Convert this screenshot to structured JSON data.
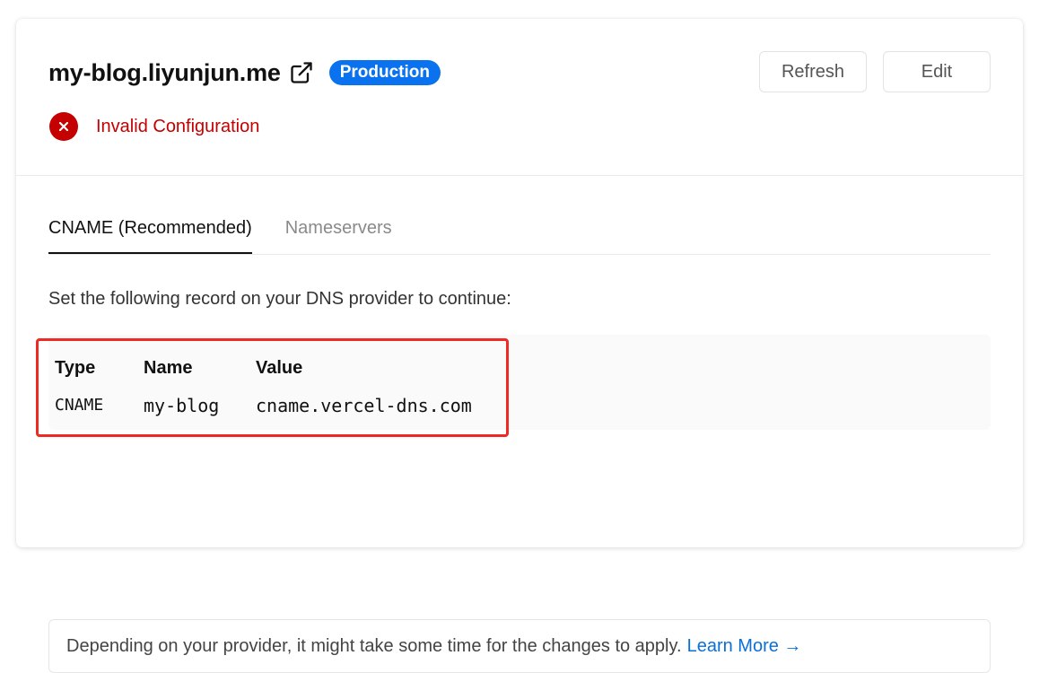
{
  "domain": {
    "name": "my-blog.liyunjun.me",
    "badge": "Production",
    "status": "Invalid Configuration"
  },
  "buttons": {
    "refresh": "Refresh",
    "edit": "Edit"
  },
  "tabs": [
    {
      "label": "CNAME (Recommended)",
      "active": true
    },
    {
      "label": "Nameservers",
      "active": false
    }
  ],
  "instruction": "Set the following record on your DNS provider to continue:",
  "record": {
    "headers": [
      "Type",
      "Name",
      "Value"
    ],
    "row": [
      "CNAME",
      "my-blog",
      "cname.vercel-dns.com"
    ]
  },
  "notice": {
    "text": "Depending on your provider, it might take some time for the changes to apply.",
    "link": "Learn More →"
  },
  "colors": {
    "badge_bg": "#0a72ef",
    "error": "#c50000",
    "link": "#0b6fd6",
    "highlight": "#ee2a22"
  },
  "icons": {
    "external": "external-link-icon",
    "error": "error-x-icon"
  }
}
